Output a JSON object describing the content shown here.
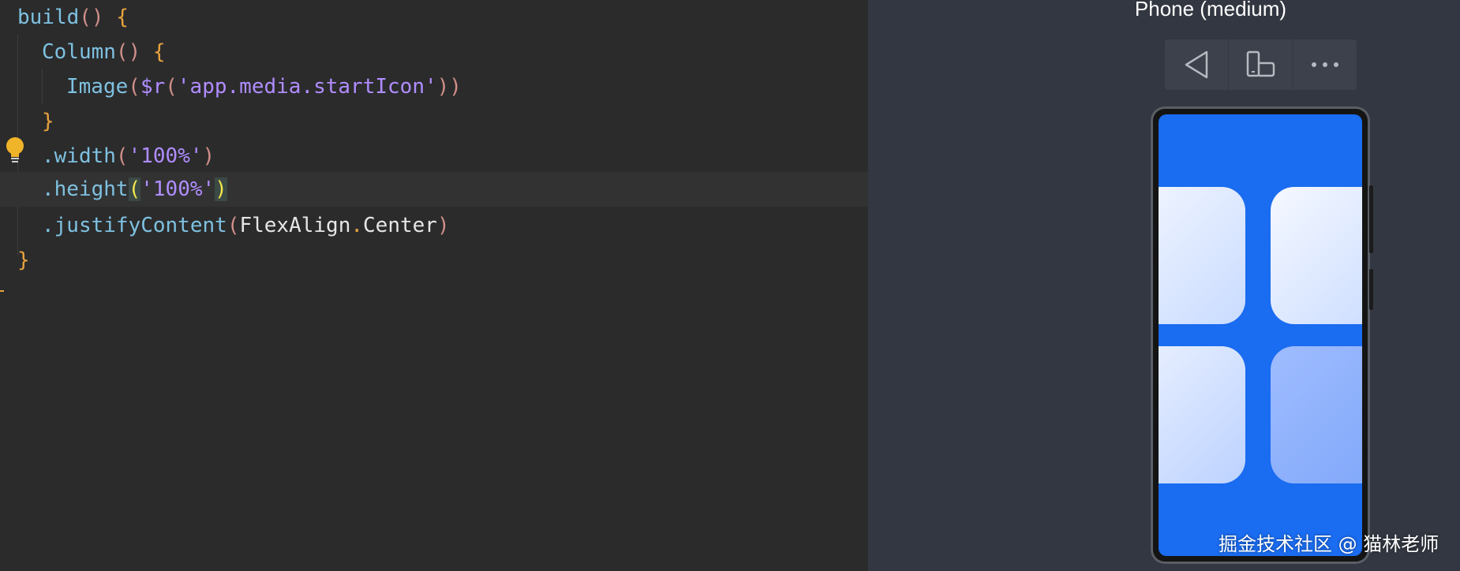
{
  "editor": {
    "lines": [
      {
        "tokens": [
          [
            "build",
            "tok-fn"
          ],
          [
            "()",
            "tok-paren"
          ],
          [
            " ",
            "tok-plain"
          ],
          [
            "{",
            "tok-brace"
          ]
        ]
      },
      {
        "tokens": [
          [
            "Column",
            "tok-fn"
          ],
          [
            "()",
            "tok-paren"
          ],
          [
            " ",
            "tok-plain"
          ],
          [
            "{",
            "tok-brace"
          ]
        ]
      },
      {
        "tokens": [
          [
            "Image",
            "tok-fn"
          ],
          [
            "(",
            "tok-paren"
          ],
          [
            "$r",
            "tok-var"
          ],
          [
            "(",
            "tok-paren"
          ],
          [
            "'app.media.startIcon'",
            "tok-str"
          ],
          [
            "))",
            "tok-paren"
          ]
        ]
      },
      {
        "tokens": [
          [
            "}",
            "tok-brace"
          ]
        ]
      },
      {
        "tokens": [
          [
            ".width",
            "tok-fn"
          ],
          [
            "(",
            "tok-paren"
          ],
          [
            "'100%'",
            "tok-str"
          ],
          [
            ")",
            "tok-paren"
          ]
        ]
      },
      {
        "tokens": [
          [
            ".height",
            "tok-fn"
          ],
          [
            "(",
            "tok-match"
          ],
          [
            "'100%'",
            "tok-str"
          ],
          [
            ")",
            "tok-match"
          ]
        ]
      },
      {
        "tokens": [
          [
            ".justifyContent",
            "tok-fn"
          ],
          [
            "(",
            "tok-paren"
          ],
          [
            "FlexAlign",
            "tok-plain"
          ],
          [
            ".",
            "tok-brace"
          ],
          [
            "Center",
            "tok-plain"
          ],
          [
            ")",
            "tok-paren"
          ]
        ]
      },
      {
        "tokens": [
          [
            "}",
            "tok-brace"
          ]
        ]
      }
    ],
    "current_line": 5
  },
  "preview": {
    "device_title": "Phone (medium)",
    "toolbar": {
      "back_icon": "back-triangle-icon",
      "rotate_icon": "device-rotate-icon",
      "more_icon": "more-icon"
    },
    "screen_color": "#1a6cf0",
    "app_icon": "start-icon"
  },
  "watermark": "掘金技术社区 @ 猫林老师",
  "colors": {
    "editor_bg": "#2b2b2c",
    "preview_bg": "#323741",
    "accent": "#1a6cf0"
  }
}
